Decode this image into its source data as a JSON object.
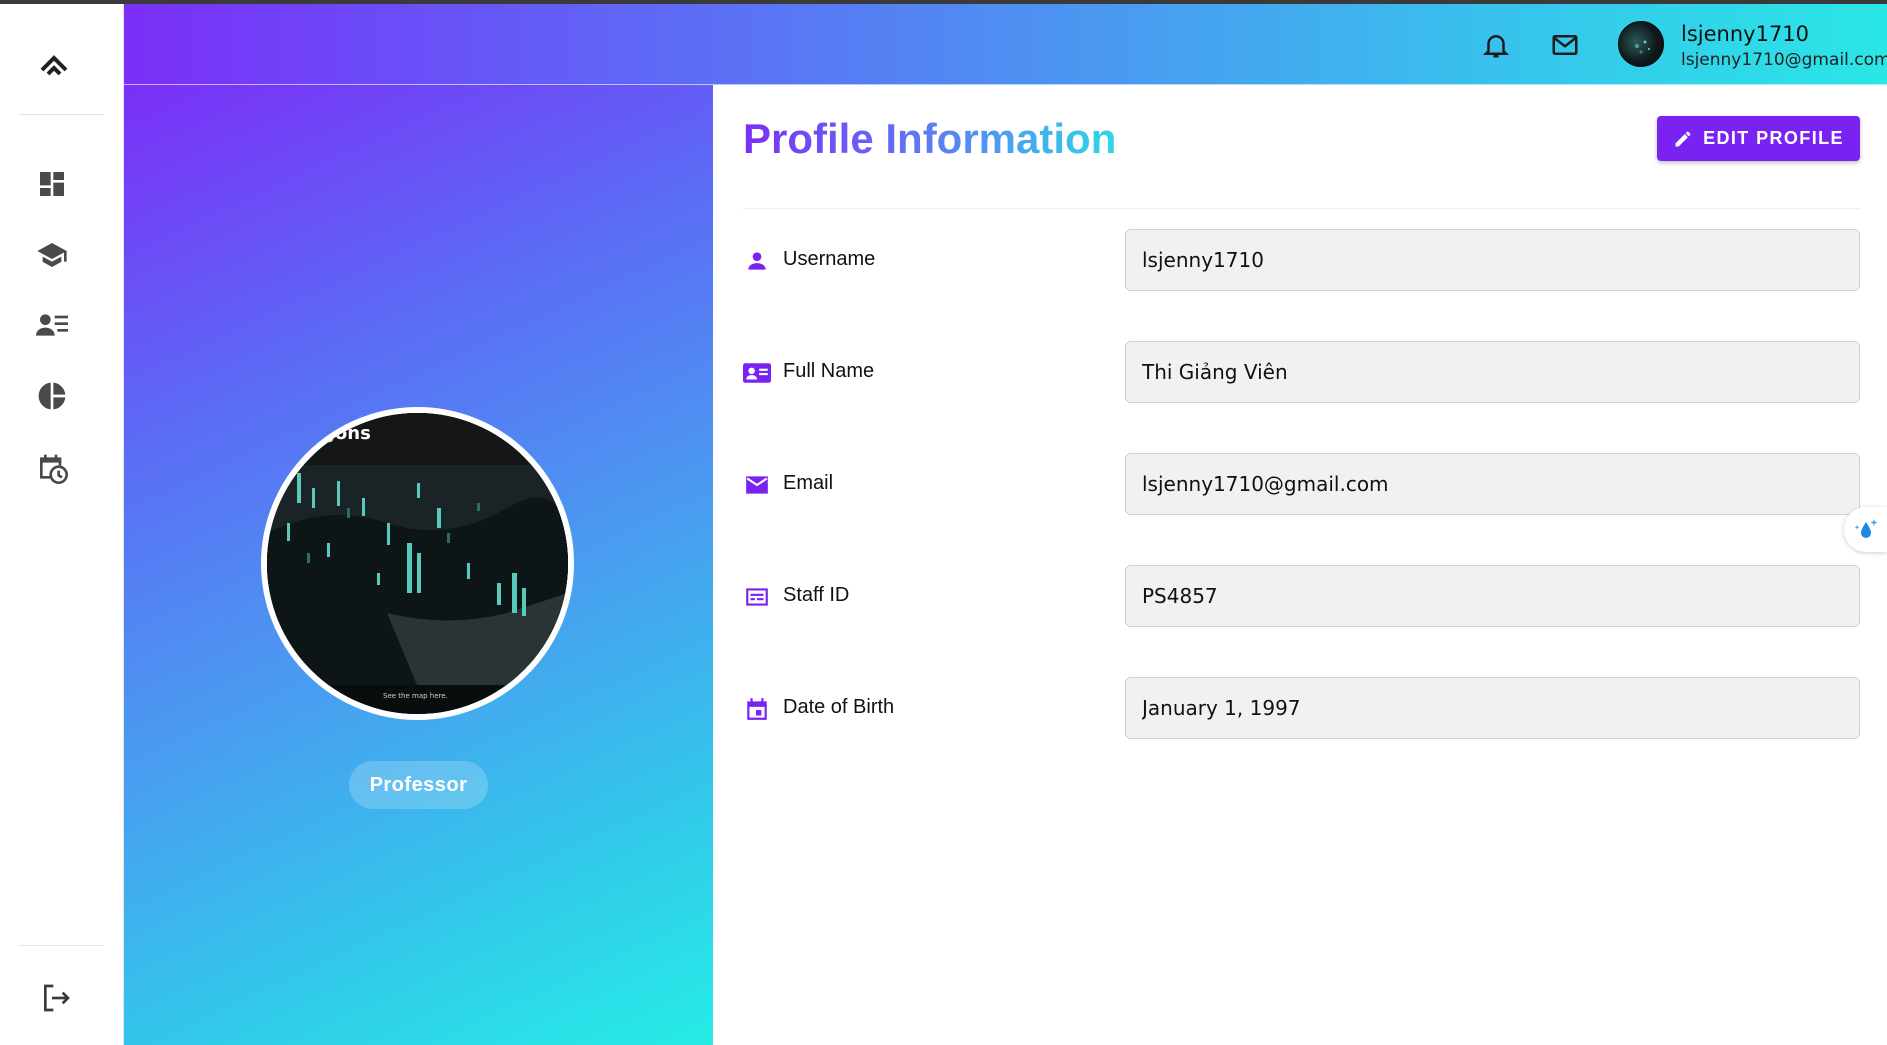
{
  "topbar": {
    "notifications_icon": "bell-icon",
    "messages_icon": "mail-icon",
    "user": {
      "name": "lsjenny1710",
      "email": "lsjenny1710@gmail.com"
    }
  },
  "sidebar": {
    "logo_icon": "double-chevron-up-icon",
    "items": [
      {
        "icon": "dashboard-icon"
      },
      {
        "icon": "school-icon"
      },
      {
        "icon": "people-list-icon"
      },
      {
        "icon": "pie-chart-icon"
      },
      {
        "icon": "calendar-clock-icon"
      }
    ],
    "logout_icon": "logout-icon"
  },
  "profile_panel": {
    "role": "Professor",
    "avatar_caption": "gons",
    "avatar_footer": "See the map here."
  },
  "main": {
    "title": "Profile Information",
    "edit_button": "EDIT PROFILE",
    "fields": [
      {
        "label": "Username",
        "value": "lsjenny1710",
        "icon": "person-icon"
      },
      {
        "label": "Full Name",
        "value": "Thi Giảng Viên",
        "icon": "id-card-icon"
      },
      {
        "label": "Email",
        "value": "lsjenny1710@gmail.com",
        "icon": "email-icon"
      },
      {
        "label": "Staff ID",
        "value": "PS4857",
        "icon": "badge-icon"
      },
      {
        "label": "Date of Birth",
        "value": "January 1, 1997",
        "icon": "calendar-icon"
      }
    ]
  },
  "colors": {
    "accent": "#7a22f2",
    "gradient_start": "#7b2ff7",
    "gradient_end": "#26ece6"
  }
}
